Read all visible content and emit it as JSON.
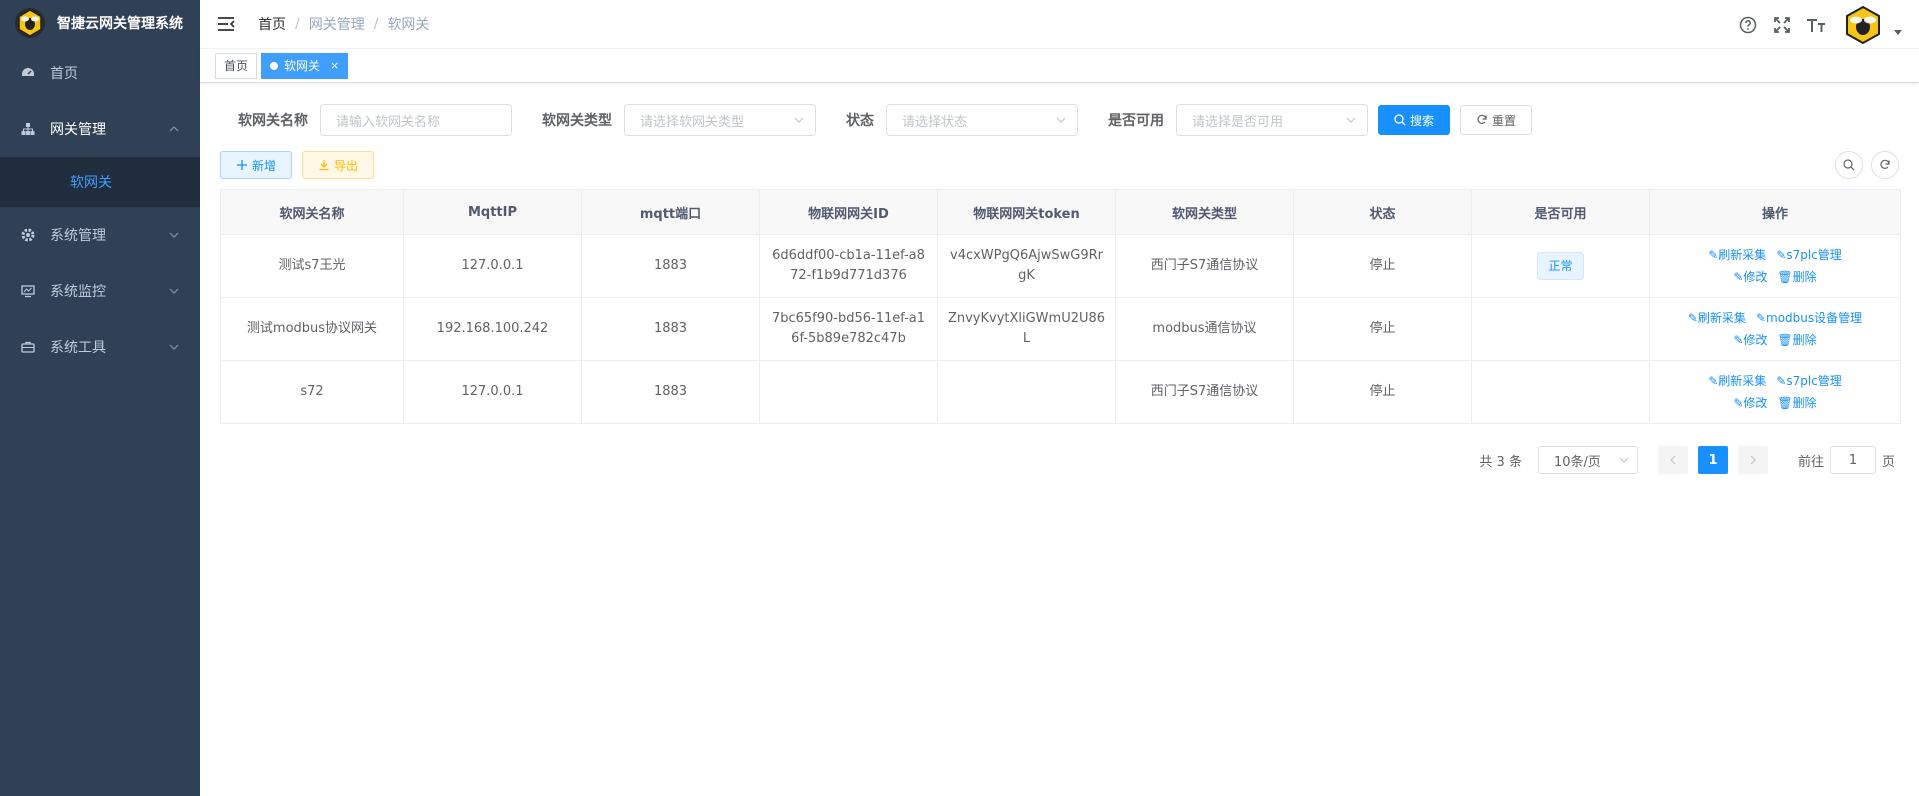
{
  "app": {
    "title": "智捷云网关管理系统"
  },
  "sidebar": {
    "items": [
      {
        "label": "首页",
        "icon": "dashboard-icon"
      },
      {
        "label": "网关管理",
        "icon": "tree-icon",
        "expanded": true,
        "children": [
          {
            "label": "软网关"
          }
        ]
      },
      {
        "label": "系统管理",
        "icon": "system-icon"
      },
      {
        "label": "系统监控",
        "icon": "monitor-icon"
      },
      {
        "label": "系统工具",
        "icon": "tool-icon"
      }
    ]
  },
  "breadcrumb": [
    "首页",
    "网关管理",
    "软网关"
  ],
  "tags": [
    {
      "label": "首页",
      "active": false
    },
    {
      "label": "软网关",
      "active": true
    }
  ],
  "search": {
    "name_label": "软网关名称",
    "name_placeholder": "请输入软网关名称",
    "type_label": "软网关类型",
    "type_placeholder": "请选择软网关类型",
    "status_label": "状态",
    "status_placeholder": "请选择状态",
    "available_label": "是否可用",
    "available_placeholder": "请选择是否可用",
    "search_button": "搜索",
    "reset_button": "重置"
  },
  "toolbar": {
    "add_button": "新增",
    "export_button": "导出"
  },
  "table": {
    "columns": [
      "软网关名称",
      "MqttIP",
      "mqtt端口",
      "物联网网关ID",
      "物联网网关token",
      "软网关类型",
      "状态",
      "是否可用",
      "操作"
    ],
    "rows": [
      {
        "name": "测试s7王光",
        "ip": "127.0.0.1",
        "port": "1883",
        "gateway_id": "6d6ddf00-cb1a-11ef-a872-f1b9d771d376",
        "token": "v4cxWPgQ6AjwSwG9RrgK",
        "type": "西门子S7通信协议",
        "status": "停止",
        "available": "正常",
        "actions": [
          "刷新采集",
          "s7plc管理",
          "修改",
          "删除"
        ]
      },
      {
        "name": "测试modbus协议网关",
        "ip": "192.168.100.242",
        "port": "1883",
        "gateway_id": "7bc65f90-bd56-11ef-a16f-5b89e782c47b",
        "token": "ZnvyKvytXliGWmU2U86L",
        "type": "modbus通信协议",
        "status": "停止",
        "available": "",
        "actions": [
          "刷新采集",
          "modbus设备管理",
          "修改",
          "删除"
        ]
      },
      {
        "name": "s72",
        "ip": "127.0.0.1",
        "port": "1883",
        "gateway_id": "",
        "token": "",
        "type": "西门子S7通信协议",
        "status": "停止",
        "available": "",
        "actions": [
          "刷新采集",
          "s7plc管理",
          "修改",
          "删除"
        ]
      }
    ]
  },
  "pagination": {
    "total": "共 3 条",
    "page_size": "10条/页",
    "current_page": "1",
    "goto_label": "前往",
    "goto_value": "1",
    "page_suffix": "页"
  },
  "colors": {
    "sidebar_bg": "#304156",
    "primary": "#1890ff",
    "active_submenu": "#409eff"
  }
}
